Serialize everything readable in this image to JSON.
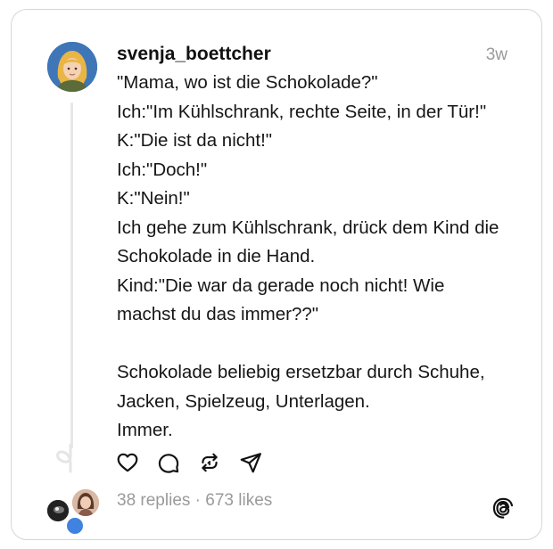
{
  "post": {
    "author": {
      "username": "svenja_boettcher",
      "avatar_icon": "avatar-illustration-blonde-woman"
    },
    "timestamp": "3w",
    "lines": [
      "\"Mama, wo ist die Schokolade?\"",
      "Ich:\"Im Kühlschrank, rechte Seite, in der Tür!\"",
      "K:\"Die ist da nicht!\"",
      "Ich:\"Doch!\"",
      "K:\"Nein!\"",
      "Ich gehe zum Kühlschrank, drück dem Kind die",
      "Schokolade in die Hand.",
      "Kind:\"Die war da gerade noch nicht! Wie",
      "machst du das immer??\"",
      "",
      "Schokolade beliebig ersetzbar durch Schuhe,",
      "Jacken, Spielzeug, Unterlagen.",
      "Immer."
    ]
  },
  "actions": {
    "icons": [
      "heart-icon",
      "comment-icon",
      "repost-icon",
      "share-icon"
    ]
  },
  "stats": {
    "replies": "38 replies",
    "separator": " · ",
    "likes": "673 likes"
  },
  "footer": {
    "logo_icon": "threads-logo-icon"
  },
  "colors": {
    "text": "#161616",
    "muted": "#9a9a9a",
    "border": "#d6d6d6"
  }
}
